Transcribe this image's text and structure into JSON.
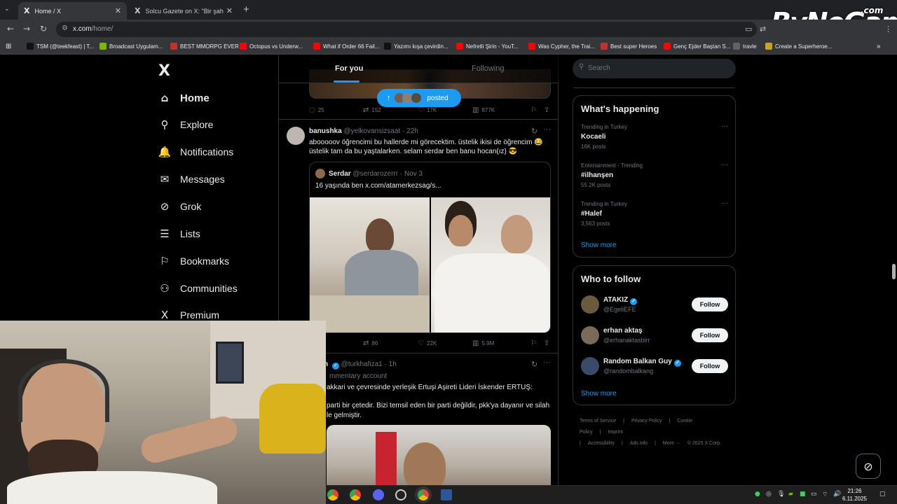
{
  "browser": {
    "tabs": [
      {
        "title": "Home / X",
        "active": true
      },
      {
        "title": "Solcu Gazete on X: \"Bir şahıs, Ya",
        "active": false
      }
    ],
    "url_host": "x.com",
    "url_path": "/home/",
    "bookmarks": [
      {
        "label": "TSM (@teekfeast) | T...",
        "icon": "tiktok-icon",
        "color": "#111111"
      },
      {
        "label": "Broadcast Uygulam...",
        "icon": "nvidia-icon",
        "color": "#76b900"
      },
      {
        "label": "BEST MMORPG EVER",
        "icon": "u-icon",
        "color": "#c4302b"
      },
      {
        "label": "Octopus vs Underw...",
        "icon": "youtube-icon",
        "color": "#ff0000"
      },
      {
        "label": "What if Order 66 Fail...",
        "icon": "youtube-icon",
        "color": "#ff0000"
      },
      {
        "label": "Yazımı kışa çevirdin...",
        "icon": "tiktok-icon",
        "color": "#111111"
      },
      {
        "label": "Nefretli Şirin - YouT...",
        "icon": "youtube-icon",
        "color": "#ff0000"
      },
      {
        "label": "Was Cypher, the Trai...",
        "icon": "youtube-icon",
        "color": "#ff0000"
      },
      {
        "label": "Best super Heroes",
        "icon": "u-icon",
        "color": "#c4302b"
      },
      {
        "label": "Genç Ejder Baştan S...",
        "icon": "youtube-icon",
        "color": "#ff0000"
      },
      {
        "label": "travle",
        "icon": "globe-icon",
        "color": "#5f6368"
      },
      {
        "label": "Create a Superheroe...",
        "icon": "page-icon",
        "color": "#c9a227"
      }
    ],
    "watermark": "ByNoGame",
    "watermark_suffix": ".com"
  },
  "nav": {
    "items": [
      {
        "label": "Home",
        "icon": "home-icon",
        "glyph": "⌂"
      },
      {
        "label": "Explore",
        "icon": "search-icon",
        "glyph": "⚲"
      },
      {
        "label": "Notifications",
        "icon": "bell-icon",
        "glyph": "🔔"
      },
      {
        "label": "Messages",
        "icon": "envelope-icon",
        "glyph": "✉"
      },
      {
        "label": "Grok",
        "icon": "grok-icon",
        "glyph": "⊘"
      },
      {
        "label": "Lists",
        "icon": "list-icon",
        "glyph": "☰"
      },
      {
        "label": "Bookmarks",
        "icon": "bookmark-icon",
        "glyph": "⚐"
      },
      {
        "label": "Communities",
        "icon": "communities-icon",
        "glyph": "⚇"
      },
      {
        "label": "Premium",
        "icon": "x-icon",
        "glyph": "X"
      }
    ]
  },
  "timeline": {
    "tabs": {
      "for_you": "For you",
      "following": "Following"
    },
    "posted_pill": "posted",
    "prev_post_actions": {
      "replies": "25",
      "reposts": "152",
      "likes": "17K",
      "views": "877K"
    },
    "post1": {
      "name": "banushka",
      "handle": "@yelkovansizsaat",
      "time": "· 22h",
      "text": "abooooov öğrencimi bu hallerde mi görecektim. üstelik ikisi de öğrencim 😂 üstelik tam da bu yaştalarken. selam serdar ben banu hocan(ız) 😎",
      "quote": {
        "name": "Serdar",
        "handle": "@serdarozerrr",
        "date": "· Nov 3",
        "text": "16 yaşında ben  x.com/atamerkezsag/s..."
      },
      "actions": {
        "reposts": "86",
        "likes": "22K",
        "views": "5.9M"
      }
    },
    "post2": {
      "name_partial": "n",
      "handle": "@turkhafiza1",
      "time": "· 1h",
      "label": "mmentary account",
      "line1": "akkari ve çevresinde yerleşik Ertuşi Aşireti Lideri İskender ERTUŞ:",
      "line2": "parti bir çetedir. Bizi temsil eden bir parti değildir, pkk'ya dayanır ve silah",
      "line3": "le gelmiştir."
    }
  },
  "widgets": {
    "search_placeholder": "Search",
    "happening_title": "What's happening",
    "trends": [
      {
        "meta": "Trending in Turkey",
        "name": "Kocaeli",
        "count": "16K posts"
      },
      {
        "meta": "Entertainment · Trending",
        "name": "#ilhanşen",
        "count": "55.2K posts"
      },
      {
        "meta": "Trending in Turkey",
        "name": "#Halef",
        "count": "3,563 posts"
      }
    ],
    "show_more": "Show more",
    "wtf_title": "Who to follow",
    "wtf": [
      {
        "name": "ATAKIZ",
        "handle": "@EgeliEFE",
        "verified": true,
        "color": "#6a5a40"
      },
      {
        "name": "erhan aktaş",
        "handle": "@erhanaktasbirr",
        "verified": false,
        "color": "#7a6a5a"
      },
      {
        "name": "Random Balkan Guy",
        "handle": "@randombalkang",
        "verified": true,
        "color": "#3a4a6a"
      }
    ],
    "follow_label": "Follow",
    "footer": [
      "Terms of Service",
      "|",
      "Privacy Policy",
      "|",
      "Cookie Policy",
      "|",
      "Imprint",
      "|",
      "Accessibility",
      "|",
      "Ads info",
      "|",
      "More ···",
      "© 2025 X Corp."
    ]
  },
  "taskbar": {
    "time": "21:26",
    "date": "6.11.2025"
  },
  "colors": {
    "accent": "#1d9bf0",
    "background": "#000000",
    "border": "#2f3336",
    "muted": "#71767b"
  }
}
